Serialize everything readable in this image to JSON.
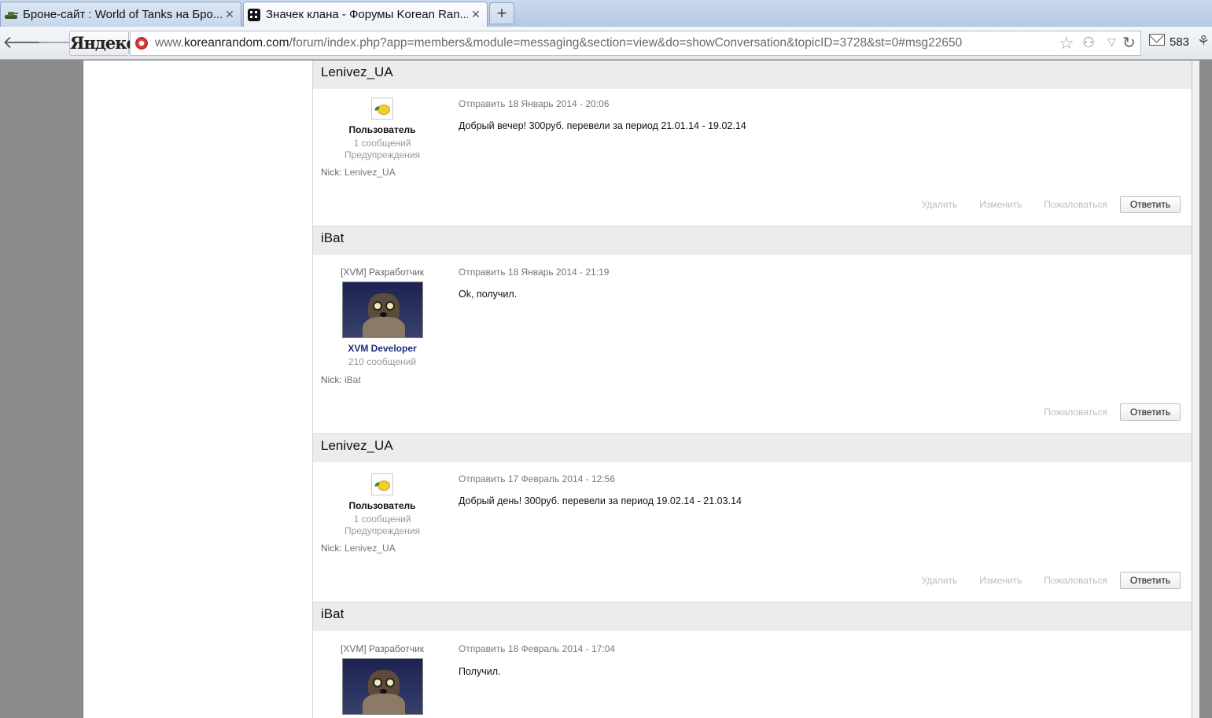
{
  "browser": {
    "tabs": [
      {
        "title": "Броне-сайт : World of Tanks на Бро...",
        "active": false,
        "icon": "tank-icon"
      },
      {
        "title": "Значек клана - Форумы Korean Ran...",
        "active": true,
        "icon": "site-logo-icon"
      }
    ],
    "new_tab_label": "+",
    "search_brand": "Яндекс",
    "url_prefix": "www.",
    "url_host": "koreanrandom.com",
    "url_path": "/forum/index.php?app=members&module=messaging&section=view&do=showConversation&topicID=3728&st=0#msg22650",
    "mail_count": "583"
  },
  "conversation": {
    "posts": [
      {
        "author": "Lenivez_UA",
        "role": "Пользователь",
        "count": "1 сообщений",
        "warnings": "Предупреждения",
        "nick_label": "Nick:",
        "nick": "Lenivez_UA",
        "date": "Отправить 18 Январь 2014 - 20:06",
        "text": "Добрый вечер! 300руб. перевели за период 21.01.14 - 19.02.14",
        "actions": [
          "Удалить",
          "Изменить",
          "Пожаловаться"
        ],
        "reply": "Ответить"
      },
      {
        "author": "iBat",
        "group": "[XVM] Разработчик",
        "role": "XVM Developer",
        "count": "210 сообщений",
        "nick_label": "Nick:",
        "nick": "iBat",
        "date": "Отправить 18 Январь 2014 - 21:19",
        "text": "Ok, получил.",
        "actions": [
          "Пожаловаться"
        ],
        "reply": "Ответить"
      },
      {
        "author": "Lenivez_UA",
        "role": "Пользователь",
        "count": "1 сообщений",
        "warnings": "Предупреждения",
        "nick_label": "Nick:",
        "nick": "Lenivez_UA",
        "date": "Отправить 17 Февраль 2014 - 12:56",
        "text": "Добрый день! 300руб. перевели за период 19.02.14 - 21.03.14",
        "actions": [
          "Удалить",
          "Изменить",
          "Пожаловаться"
        ],
        "reply": "Ответить"
      },
      {
        "author": "iBat",
        "group": "[XVM] Разработчик",
        "date": "Отправить 18 Февраль 2014 - 17:04",
        "text": "Получил."
      }
    ]
  },
  "colors": {
    "header_bg": "#ececec",
    "muted_action": "#bdbdbd",
    "dev_role": "#1c2d7a"
  }
}
